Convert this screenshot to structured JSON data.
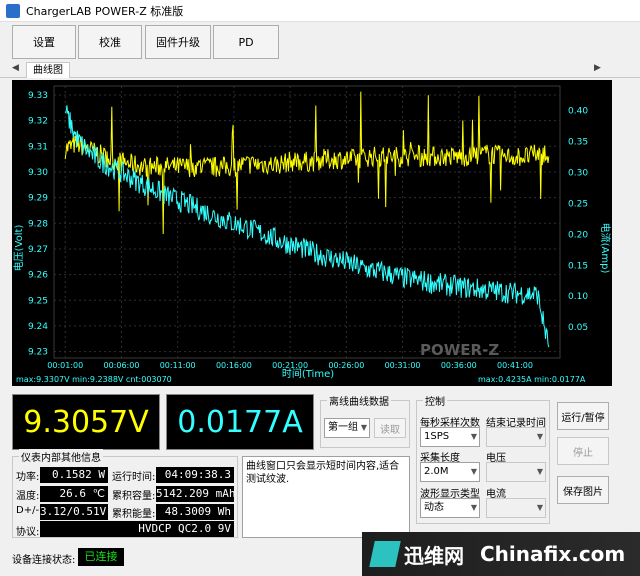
{
  "window": {
    "title": "ChargerLAB POWER-Z 标准版"
  },
  "toolbar": {
    "settings": "设置",
    "calibrate": "校准",
    "firmware": "固件升级",
    "pd": "PD"
  },
  "tab": {
    "label": "曲线图"
  },
  "chart_data": {
    "type": "line",
    "xlabel": "时间(Time)",
    "ylabel_left": "电压(Volt)",
    "ylabel_right": "电流(Amp)",
    "x_ticks": [
      "00:01:00",
      "00:06:00",
      "00:11:00",
      "00:16:00",
      "00:21:00",
      "00:26:00",
      "00:31:00",
      "00:36:00",
      "00:41:00"
    ],
    "y_left_ticks": [
      "9.33",
      "9.32",
      "9.31",
      "9.30",
      "9.29",
      "9.28",
      "9.27",
      "9.26",
      "9.25",
      "9.24",
      "9.23"
    ],
    "y_right_ticks": [
      "0.40",
      "0.35",
      "0.30",
      "0.25",
      "0.20",
      "0.15",
      "0.10",
      "0.05"
    ],
    "ylim_left": [
      9.2275,
      9.3335
    ],
    "ylim_right": [
      0.0,
      0.44
    ],
    "grid": true,
    "stats_left": "max:9.3307V min:9.2388V cnt:003070",
    "stats_right": "max:0.4235A min:0.0177A",
    "brand": "POWER-Z",
    "series": [
      {
        "name": "电压",
        "color": "#ffff00",
        "axis": "left",
        "x": [
          1,
          2,
          3,
          4,
          5,
          6,
          7,
          8,
          9,
          10,
          11,
          12,
          13,
          14,
          15,
          16,
          17,
          18,
          19,
          20,
          21,
          22,
          23,
          24,
          25,
          26,
          27,
          28,
          29,
          30,
          31,
          32,
          33,
          34,
          35,
          36,
          37,
          38,
          39,
          40,
          41,
          42,
          43,
          44
        ],
        "y": [
          9.309,
          9.311,
          9.309,
          9.307,
          9.305,
          9.304,
          9.303,
          9.302,
          9.302,
          9.302,
          9.302,
          9.302,
          9.302,
          9.302,
          9.302,
          9.302,
          9.303,
          9.303,
          9.303,
          9.303,
          9.304,
          9.304,
          9.304,
          9.305,
          9.305,
          9.305,
          9.305,
          9.306,
          9.306,
          9.306,
          9.306,
          9.306,
          9.306,
          9.306,
          9.306,
          9.306,
          9.306,
          9.307,
          9.307,
          9.306,
          9.306,
          9.306,
          9.307,
          9.306
        ]
      },
      {
        "name": "电流",
        "color": "#33ffff",
        "axis": "right",
        "x": [
          1,
          2,
          3,
          4,
          5,
          6,
          7,
          8,
          9,
          10,
          11,
          12,
          13,
          14,
          15,
          16,
          17,
          18,
          19,
          20,
          21,
          22,
          23,
          24,
          25,
          26,
          27,
          28,
          29,
          30,
          31,
          32,
          33,
          34,
          35,
          36,
          37,
          38,
          39,
          40,
          41,
          42,
          43,
          44
        ],
        "y": [
          0.4,
          0.355,
          0.335,
          0.32,
          0.31,
          0.3,
          0.29,
          0.28,
          0.272,
          0.262,
          0.255,
          0.248,
          0.24,
          0.232,
          0.225,
          0.218,
          0.212,
          0.205,
          0.198,
          0.19,
          0.184,
          0.178,
          0.171,
          0.165,
          0.16,
          0.155,
          0.148,
          0.143,
          0.14,
          0.135,
          0.13,
          0.127,
          0.124,
          0.12,
          0.118,
          0.115,
          0.113,
          0.111,
          0.109,
          0.107,
          0.105,
          0.104,
          0.103,
          0.0177
        ]
      }
    ]
  },
  "readouts": {
    "voltage": "9.3057V",
    "current": "0.0177A",
    "voltage_color": "#ffff00",
    "current_color": "#33ffff"
  },
  "offline": {
    "title": "离线曲线数据",
    "group": "第一组",
    "read": "读取"
  },
  "control": {
    "title": "控制",
    "rate_label": "每秒采样次数",
    "rate_value": "1SPS",
    "end_label": "结束记录时间",
    "len_label": "采集长度",
    "len_value": "2.0M",
    "volt_label": "电压",
    "wave_label": "波形显示类型",
    "wave_value": "动态",
    "curr_label": "电流"
  },
  "buttons": {
    "run_pause": "运行/暂停",
    "stop": "停止",
    "save_image": "保存图片"
  },
  "meter": {
    "title": "仪表内部其他信息",
    "power_label": "功率:",
    "power": "0.1582 W",
    "runtime_label": "运行时间:",
    "runtime": "04:09:38.3",
    "temp_label": "温度:",
    "temp": "26.6 ℃",
    "capacity_label": "累积容量:",
    "capacity": "5142.209 mAh",
    "dpdm_label": "D+/-:",
    "dpdm": "3.12/0.51V",
    "energy_label": "累积能量:",
    "energy": "48.3009 Wh",
    "protocol_label": "协议:",
    "protocol": "HVDCP QC2.0 9V"
  },
  "note": {
    "text": "曲线窗口只会显示短时间内容,适合测试纹波."
  },
  "status": {
    "label": "设备连接状态:",
    "value": "已连接"
  },
  "watermark": {
    "site_a": "迅维网",
    "site_b": "Chinafix.com"
  }
}
